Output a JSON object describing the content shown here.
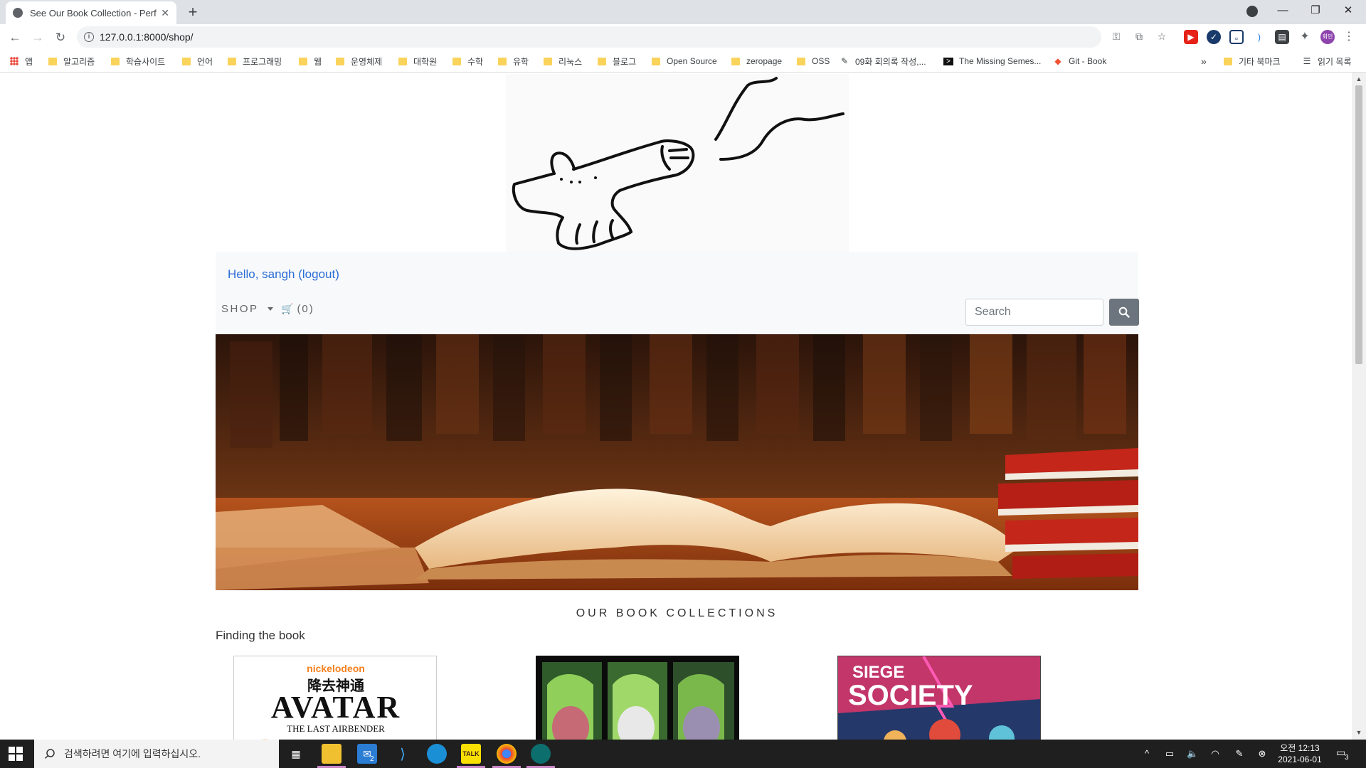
{
  "browser": {
    "tab_title": "See Our Book Collection - Perfe",
    "url": "127.0.0.1:8000/shop/",
    "bookmarks": [
      {
        "label": "앱",
        "kind": "apps"
      },
      {
        "label": "알고리즘",
        "kind": "folder"
      },
      {
        "label": "학습사이트",
        "kind": "folder"
      },
      {
        "label": "언어",
        "kind": "folder"
      },
      {
        "label": "프로그래밍",
        "kind": "folder"
      },
      {
        "label": "웹",
        "kind": "folder"
      },
      {
        "label": "운영체제",
        "kind": "folder"
      },
      {
        "label": "대학원",
        "kind": "folder"
      },
      {
        "label": "수학",
        "kind": "folder"
      },
      {
        "label": "유학",
        "kind": "folder"
      },
      {
        "label": "리눅스",
        "kind": "folder"
      },
      {
        "label": "블로그",
        "kind": "folder"
      },
      {
        "label": "Open Source",
        "kind": "folder"
      },
      {
        "label": "zeropage",
        "kind": "folder"
      },
      {
        "label": "OSS",
        "kind": "folder"
      },
      {
        "label": "09화 회의록 작성,...",
        "kind": "page"
      },
      {
        "label": "The Missing Semes...",
        "kind": "page"
      },
      {
        "label": "Git - Book",
        "kind": "page"
      }
    ],
    "more_bookmarks": "»",
    "other_bookmarks": "기타 북마크",
    "reading_list": "읽기 목록",
    "profile_initials": "회민"
  },
  "site": {
    "greeting": "Hello, sangh (logout)",
    "nav_shop": "SHOP",
    "cart": "(0)",
    "search_placeholder": "Search",
    "section_title": "OUR BOOK COLLECTIONS",
    "subtitle": "Finding the book",
    "books": [
      {
        "title_line1": "nickelodeon",
        "title_line2": "AVATAR",
        "title_line3": "THE LAST AIRBENDER",
        "title_cjk": "降去神通"
      },
      {
        "title": ""
      },
      {
        "title_line1": "SIEGE",
        "title_line2": "SOCIETY"
      }
    ]
  },
  "taskbar": {
    "search_placeholder": "검색하려면 여기에 입력하십시오.",
    "time": "오전 12:13",
    "date": "2021-06-01",
    "mail_badge": "2",
    "notification_count": "3"
  },
  "colors": {
    "link": "#2a6dd5",
    "search_button": "#6c757d",
    "header_bg": "#f8f9fa"
  }
}
